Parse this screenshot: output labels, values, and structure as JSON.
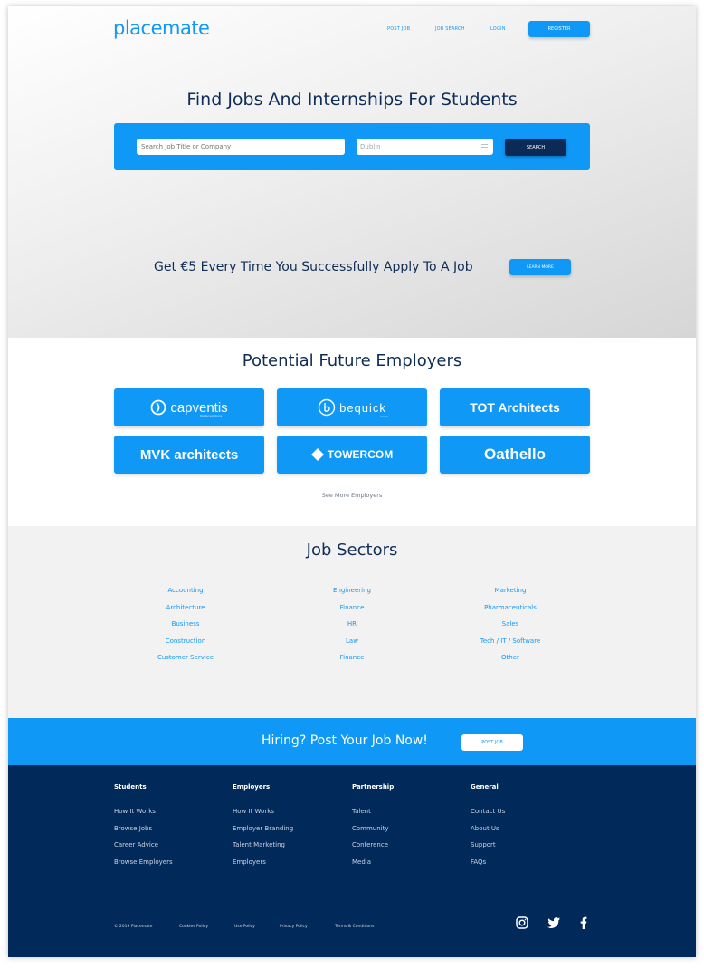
{
  "brand": {
    "logo": "placemate",
    "primary_color": "#1098f7",
    "dark_color": "#012a5a"
  },
  "nav": {
    "post_job": "POST JOB",
    "job_search": "JOB SEARCH",
    "login": "LOGIN",
    "register": "REGISTER"
  },
  "hero": {
    "title": "Find Jobs And Internships For Students",
    "search_placeholder": "Search Job Title or Company",
    "location_value": "Dublin",
    "search_button": "SEARCH",
    "promo_text": "Get €5 Every Time You Successfully Apply To A Job",
    "learn_more": "LEARN MORE"
  },
  "employers": {
    "title": "Potential Future Employers",
    "tiles": [
      {
        "name": "capventis",
        "sub": "Digital solutions"
      },
      {
        "name": "bequick",
        "sub": "media"
      },
      {
        "name": "TOT Architects"
      },
      {
        "name": "MVK architects"
      },
      {
        "name": "TOWERCOM"
      },
      {
        "name": "Oathello"
      }
    ],
    "see_more": "See More Employers"
  },
  "sectors": {
    "title": "Job Sectors",
    "columns": [
      [
        "Accounting",
        "Architecture",
        "Business",
        "Construction",
        "Customer Service"
      ],
      [
        "Engineering",
        "Finance",
        "HR",
        "Law",
        "Finance"
      ],
      [
        "Marketing",
        "Pharmaceuticals",
        "Sales",
        "Tech / IT / Software",
        "Other"
      ]
    ]
  },
  "cta": {
    "text": "Hiring? Post Your Job Now!",
    "button": "POST JOB"
  },
  "footer": {
    "columns": [
      {
        "heading": "Students",
        "links": [
          "How It Works",
          "Browse Jobs",
          "Career Advice",
          "Browse Employers"
        ]
      },
      {
        "heading": "Employers",
        "links": [
          "How It Works",
          "Employer Branding",
          "Talent Marketing",
          "Employers"
        ]
      },
      {
        "heading": "Partnership",
        "links": [
          "Talent",
          "Community",
          "Conference",
          "Media"
        ]
      },
      {
        "heading": "General",
        "links": [
          "Contact Us",
          "About Us",
          "Support",
          "FAQs"
        ]
      }
    ],
    "legal": [
      "© 2019 Placemate",
      "Cookies Policy",
      "Use Policy",
      "Privacy Policy",
      "Terms & Conditions"
    ],
    "social": [
      "instagram-icon",
      "twitter-icon",
      "facebook-icon"
    ]
  }
}
